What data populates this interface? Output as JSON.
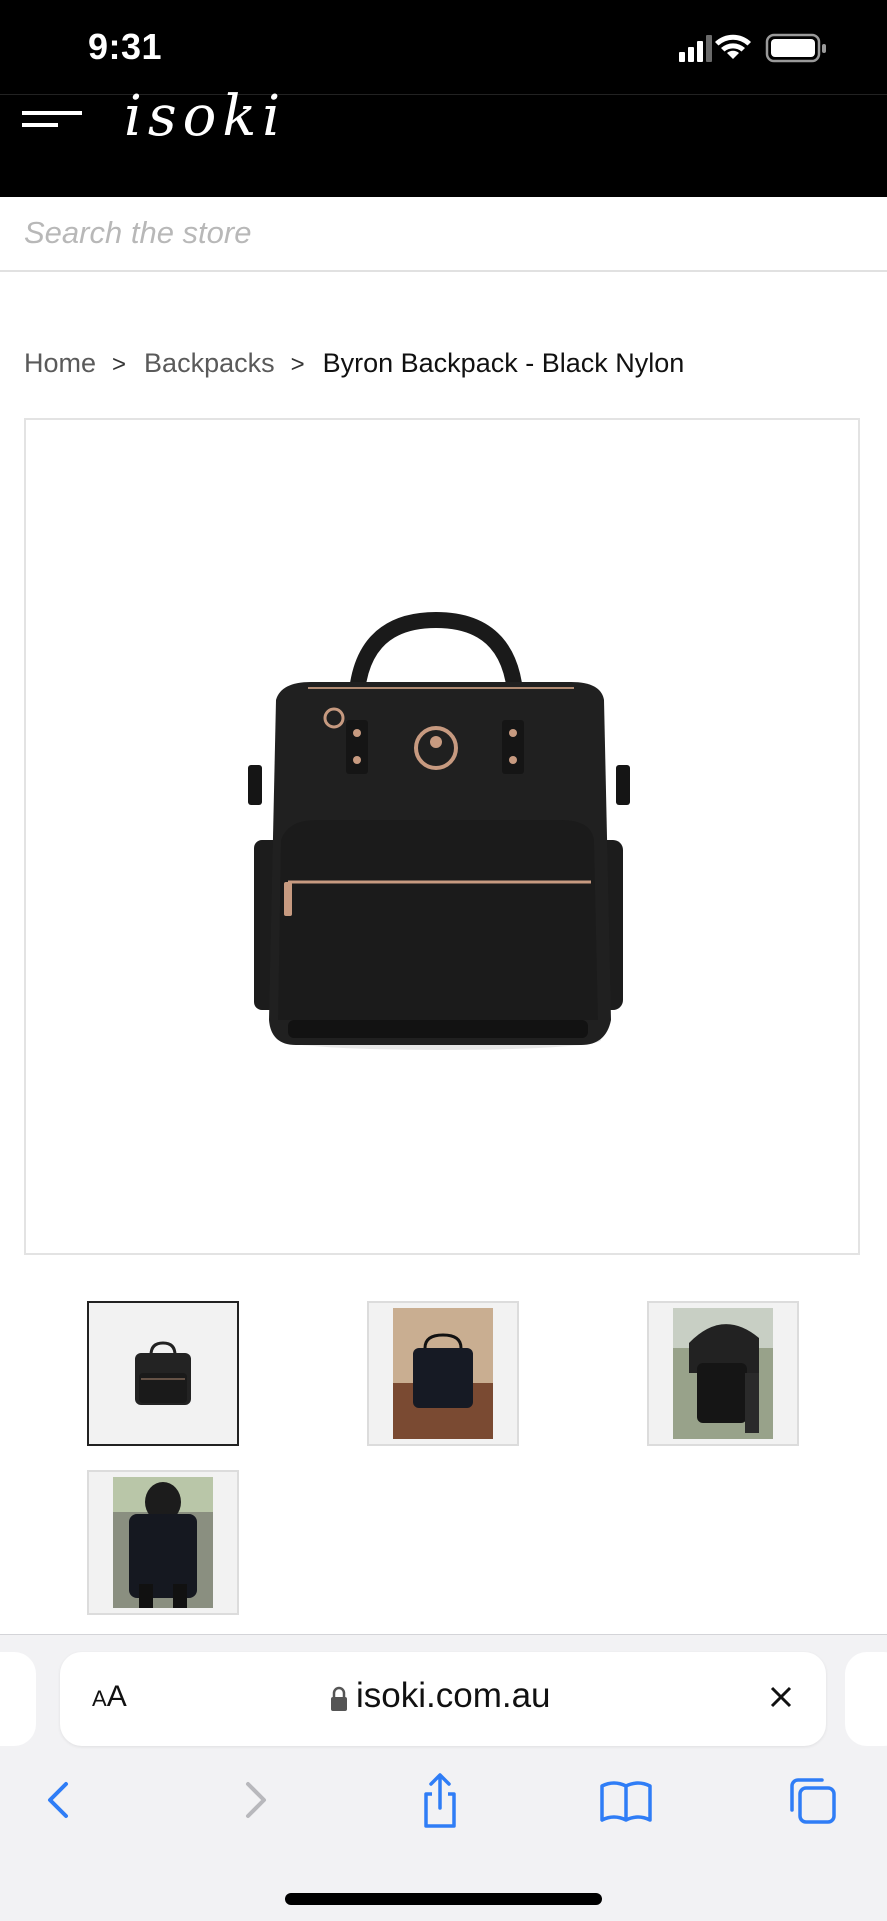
{
  "status_bar": {
    "time": "9:31"
  },
  "header": {
    "logo_text": "isoki",
    "menu_icon": "hamburger-menu-icon"
  },
  "search": {
    "placeholder": "Search the store"
  },
  "breadcrumb": {
    "items": [
      "Home",
      "Backpacks"
    ],
    "current": "Byron Backpack - Black Nylon",
    "separator": ">"
  },
  "product": {
    "main_image": "black-nylon-backpack",
    "thumbnails": [
      {
        "name": "thumb-backpack-studio",
        "active": true
      },
      {
        "name": "thumb-backpack-on-deck",
        "active": false
      },
      {
        "name": "thumb-backpack-on-stroller",
        "active": false
      },
      {
        "name": "thumb-backpack-worn",
        "active": false
      }
    ]
  },
  "browser": {
    "text_size_label_small": "A",
    "text_size_label_large": "A",
    "url": "isoki.com.au",
    "icons": [
      "back-icon",
      "forward-icon",
      "share-icon",
      "bookmarks-icon",
      "tabs-icon"
    ]
  },
  "colors": {
    "header_bg": "#000000",
    "link_blue": "#1a73e8",
    "safari_blue": "#2f7df6"
  }
}
